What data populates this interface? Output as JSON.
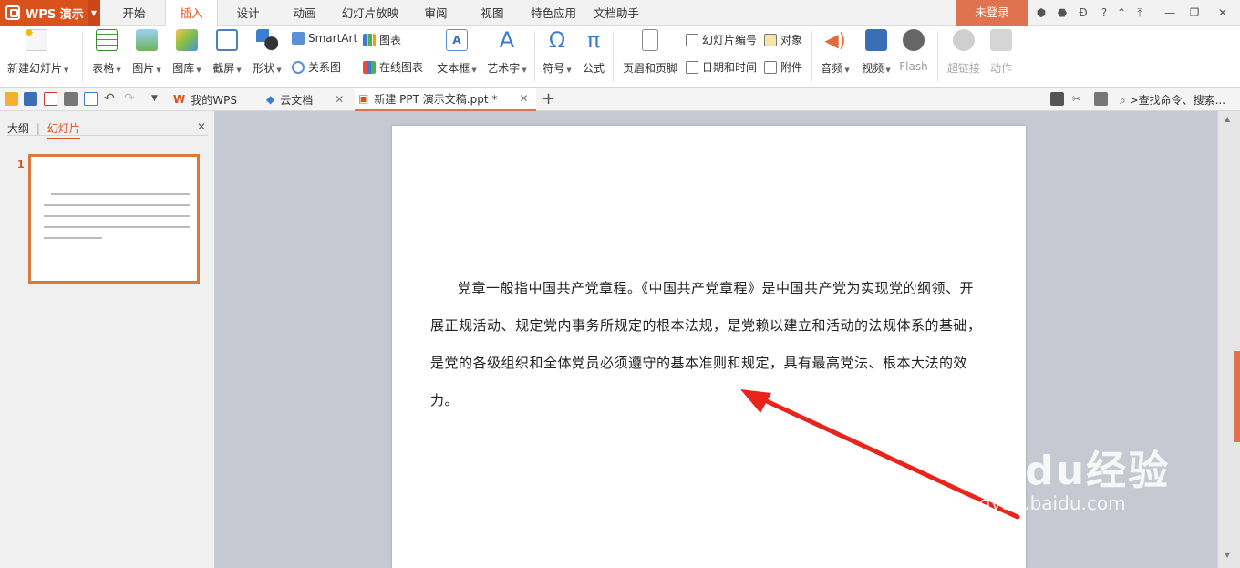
{
  "app": {
    "name": "WPS 演示"
  },
  "menu": {
    "tabs": [
      "开始",
      "插入",
      "设计",
      "动画",
      "幻灯片放映",
      "审阅",
      "视图",
      "特色应用",
      "文档助手"
    ],
    "active_tab": "插入",
    "login_label": "未登录"
  },
  "ribbon": {
    "new_slide": "新建幻灯片",
    "table": "表格",
    "picture": "图片",
    "gallery": "图库",
    "screenshot": "截屏",
    "shapes": "形状",
    "smartart": "SmartArt",
    "chart": "图表",
    "relation_chart": "关系图",
    "online_chart": "在线图表",
    "textbox": "文本框",
    "wordart": "艺术字",
    "symbol": "符号",
    "formula": "公式",
    "header_footer": "页眉和页脚",
    "slide_number": "幻灯片编号",
    "object": "对象",
    "date_time": "日期和时间",
    "attachment": "附件",
    "audio": "音频",
    "video": "视频",
    "flash": "Flash",
    "hyperlink": "超链接",
    "action": "动作"
  },
  "doc_tabs": [
    {
      "label": "我的WPS"
    },
    {
      "label": "云文档"
    },
    {
      "label": "新建 PPT 演示文稿.ppt *"
    }
  ],
  "search_placeholder": ">查找命令、搜索...",
  "left_pane": {
    "outline_tab": "大纲",
    "slides_tab": "幻灯片",
    "slide_number": "1"
  },
  "slide": {
    "body": "党章一般指中国共产党章程。《中国共产党章程》是中国共产党为实现党的纲领、开展正规活动、规定党内事务所规定的根本法规，是党赖以建立和活动的法规体系的基础，是党的各级组织和全体党员必须遵守的基本准则和规定，具有最高党法、根本大法的效力。"
  },
  "watermark": {
    "brand": "Baidu经验",
    "url": "jingyan.baidu.com"
  },
  "colors": {
    "accent": "#d9521b",
    "login_bg": "#e0734f",
    "thumb_border": "#d97a3d",
    "arrow": "#e8241c"
  }
}
